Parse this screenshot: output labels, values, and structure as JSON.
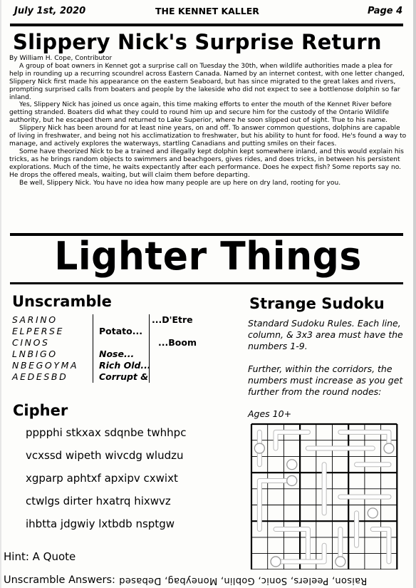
{
  "header": {
    "date": "July 1st, 2020",
    "paper": "THE KENNET KALLER",
    "page": "Page 4"
  },
  "article": {
    "headline": "Slippery Nick's Surprise Return",
    "byline": "By William H. Cope, Contributor",
    "paragraphs": [
      "A group of boat owners in Kennet got a surprise call on Tuesday the 30th, when wildlife authorities made a plea for help in rounding up a recurring scoundrel across Eastern Canada.  Named by an internet contest, with one letter changed, Slippery Nick first made his appearance on the eastern Seaboard, but has since migrated to the great lakes and rivers, prompting surprised calls from boaters and people by the lakeside who did not expect to see a bottlenose dolphin so far inland.",
      "Yes, Slippery Nick has joined us once again, this time making efforts to enter the mouth of the Kennet River before getting stranded.  Boaters did what they could to round him up and secure him for the custody of the Ontario Wildlife authority, but he escaped them and returned to Lake Superior, where he soon slipped out of sight.  True to his name.",
      "Slippery Nick has been around for at least nine years, on and off.  To answer common questions, dolphins are capable of living in freshwater, and being not his acclimatization to freshwater, but his ability to hunt for food. He's found a way to manage, and actively explores the waterways, startling Canadians and putting smiles on their faces.",
      "Some have theorized Nick to be a trained and illegally kept dolphin kept somewhere inland, and this would explain his tricks, as he brings random objects to swimmers and beachgoers, gives rides, and does tricks, in between his persistent explorations.  Much of the time, he waits expectantly after each performance.  Does he expect fish?  Some reports say no.  He drops the offered meals, waiting, but will claim them before departing.",
      "Be well, Slippery Nick.  You have no idea how many people are up here on dry land, rooting for you."
    ]
  },
  "section_title": "Lighter Things",
  "unscramble": {
    "title": "Unscramble",
    "words": [
      "SARINO",
      "ELPERSE",
      "CINOS",
      "LNBIGO",
      "NBEGOYMA",
      "AEDESBD"
    ],
    "clues": [
      "",
      "Potato...",
      "",
      "Nose...",
      "Rich Old...",
      "Corrupt &"
    ],
    "after": [
      "...D'Etre",
      "...Boom"
    ]
  },
  "cipher": {
    "title": "Cipher",
    "lines": [
      "pppphi stkxax sdqnbe twhhpc",
      "vcxssd wipeth wivcdg wludzu",
      "xgparp aphtxf apxipv cxwixt",
      "ctwlgs dirter hxatrq hixwvz",
      "ihbtta jdgwiy lxtbdb nsptgw"
    ],
    "hint": "Hint: A Quote"
  },
  "answers": {
    "label": "Unscramble Answers:",
    "text": "Raison, Peelers, Sonic, Goblin, Moneybag, Debased"
  },
  "sudoku": {
    "title": "Strange Sudoku",
    "rules": "Standard Sudoku Rules.  Each line, column, & 3x3 area must have the numbers 1-9.",
    "rules2": "Further, within the corridors, the numbers must increase as you get further from the round nodes:",
    "ages": "Ages 10+"
  }
}
